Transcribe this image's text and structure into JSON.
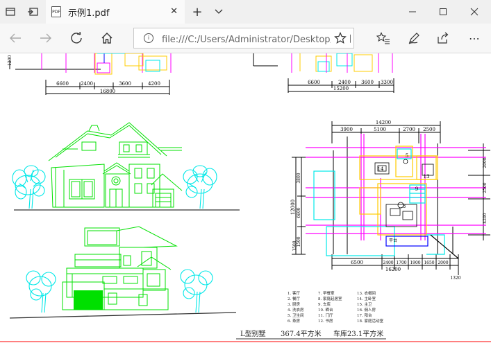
{
  "tab": {
    "title": "示例1.pdf",
    "pdf_badge": "PDF",
    "close_icon": "close-icon"
  },
  "toolbar": {
    "new_tab": "+",
    "dropdown": "⌵"
  },
  "window": {
    "minimize": "—",
    "maximize": "☐",
    "close": "✕"
  },
  "nav": {
    "back": "←",
    "forward": "→",
    "refresh": "↻",
    "home": "⌂",
    "favorite": "☆",
    "favorites_list": "☆≡",
    "notes": "✎",
    "share": "⇪",
    "more": "⋯"
  },
  "address": {
    "url": "file:///C:/Users/Administrator/Desktop/示例",
    "info": "i"
  },
  "drawing": {
    "top_left_dims": [
      "6600",
      "2400",
      "3600",
      "4200"
    ],
    "top_left_total": "16800",
    "top_left_side": "1200",
    "top_right_dims": [
      "6600",
      "2400",
      "3600",
      "3300"
    ],
    "top_right_total": "15200",
    "plan_top_total": "14200",
    "plan_top_dims": [
      "3900",
      "5100",
      "2700",
      "2500"
    ],
    "plan_bottom_dims": [
      "6500",
      "2400",
      "1700",
      "1900",
      "1650",
      "2000"
    ],
    "plan_bottom_total": "16200",
    "plan_bottom_extra": "1320",
    "plan_left_total": "12000",
    "plan_left_dims": [
      "3800",
      "6600",
      "1500"
    ],
    "plan_left_small": "1500",
    "plan_right_dims": [
      "2000",
      "2500",
      "4200"
    ],
    "plan_rooms": [
      "14",
      "5",
      "13",
      "8",
      "9"
    ],
    "plan_label": "平台",
    "legend_col1": [
      "1. 客厅",
      "2. 餐厅",
      "3. 厨房",
      "4. 洗衣房",
      "5. 卫生间",
      "6. 茶房"
    ],
    "legend_col2": [
      "7. 早餐室",
      "8. 家庭起居室",
      "9. 车库",
      "10. 晒台",
      "11. 门厅",
      "12. 书房"
    ],
    "legend_col3": [
      "13. 衣帽间",
      "14. 主卧室",
      "15. 主卫",
      "16. 佣人房",
      "17. 阳台",
      "18. 家庭活动室"
    ],
    "footer_title": "L型别墅",
    "footer_area": "367.4平方米",
    "footer_garage": "车库23.1平方米"
  },
  "colors": {
    "green": "#00e000",
    "cyan": "#00e8e8",
    "magenta": "#ff00ff",
    "yellow": "#ffcc00",
    "blue": "#0000ff",
    "red": "#ff0000"
  }
}
